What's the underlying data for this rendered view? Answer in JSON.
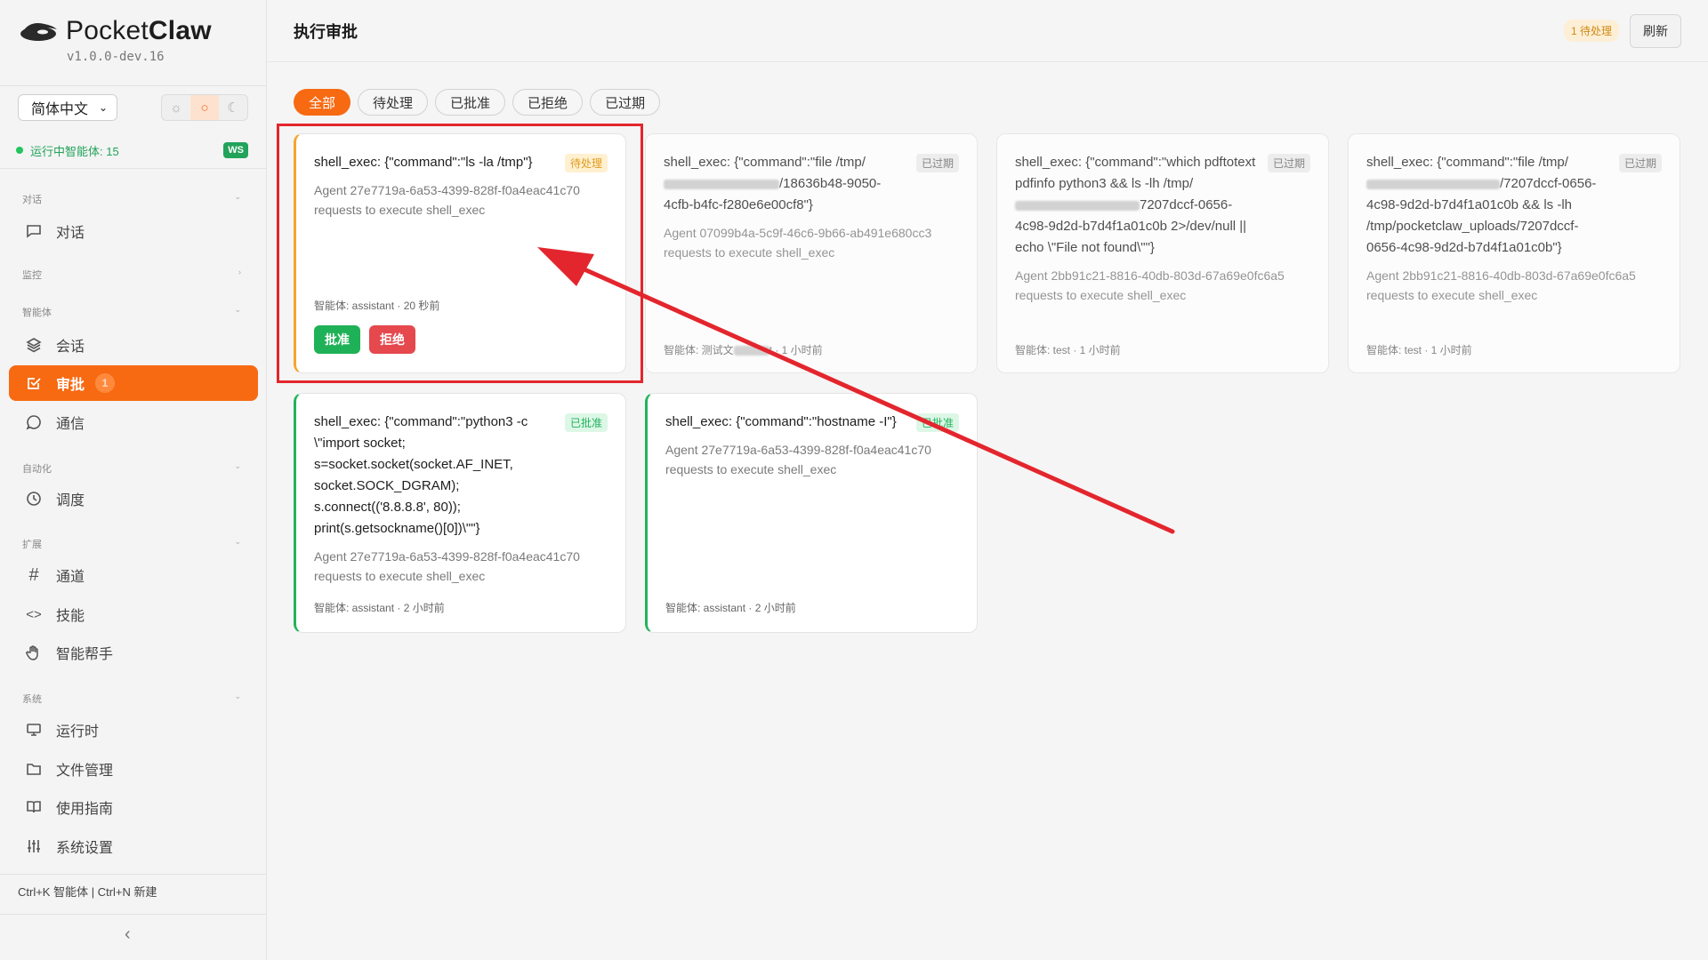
{
  "app": {
    "brand_light": "Pocket",
    "brand_bold": "Claw",
    "version": "v1.0.0-dev.16"
  },
  "sidebar": {
    "language": "简体中文",
    "theme_icons": [
      "sun-icon",
      "system-icon",
      "moon-icon"
    ],
    "status_text": "运行中智能体: 15",
    "ws_badge": "WS",
    "sections": [
      {
        "label": "对话",
        "items": [
          {
            "label": "对话",
            "icon": "chat-icon"
          }
        ]
      },
      {
        "label": "监控",
        "items": []
      },
      {
        "label": "智能体",
        "items": [
          {
            "label": "会话",
            "icon": "layers-icon"
          },
          {
            "label": "审批",
            "icon": "check-square-icon",
            "badge": "1",
            "active": true
          },
          {
            "label": "通信",
            "icon": "message-icon"
          }
        ]
      },
      {
        "label": "自动化",
        "items": [
          {
            "label": "调度",
            "icon": "clock-icon"
          }
        ]
      },
      {
        "label": "扩展",
        "items": [
          {
            "label": "通道",
            "icon": "hash-icon"
          },
          {
            "label": "技能",
            "icon": "code-icon"
          },
          {
            "label": "智能帮手",
            "icon": "hand-icon"
          }
        ]
      },
      {
        "label": "系统",
        "items": [
          {
            "label": "运行时",
            "icon": "monitor-icon"
          },
          {
            "label": "文件管理",
            "icon": "folder-icon"
          },
          {
            "label": "使用指南",
            "icon": "book-icon"
          },
          {
            "label": "系统设置",
            "icon": "sliders-icon"
          }
        ]
      }
    ],
    "shortcut_hint": "Ctrl+K 智能体 | Ctrl+N 新建",
    "collapse_label": "‹"
  },
  "header": {
    "title": "执行审批",
    "pending_pill": "1 待处理",
    "refresh_label": "刷新"
  },
  "tabs": [
    "全部",
    "待处理",
    "已批准",
    "已拒绝",
    "已过期"
  ],
  "active_tab": "全部",
  "cards": [
    {
      "command": "shell_exec: {\"command\":\"ls -la /tmp\"}",
      "status": "待处理",
      "description": "Agent 27e7719a-6a53-4399-828f-f0a4eac41c70 requests to execute shell_exec",
      "meta": "智能体: assistant · 20 秒前",
      "approve_label": "批准",
      "reject_label": "拒绝"
    },
    {
      "command_pre": "shell_exec: {\"command\":\"file /tmp/",
      "command_post": "/18636b48-9050-4cfb-b4fc-f280e6e00cf8\"}",
      "status": "已过期",
      "description": "Agent 07099b4a-5c9f-46c6-9b66-ab491e680cc3 requests to execute shell_exec",
      "meta_pre": "智能体: 测试文",
      "meta_post": "t · 1 小时前"
    },
    {
      "command_pre": "shell_exec: {\"command\":\"which pdftotext pdfinfo python3 && ls -lh /tmp/",
      "command_post": "7207dccf-0656-4c98-9d2d-b7d4f1a01c0b 2>/dev/null || echo \\\"File not found\\\"\"}",
      "status": "已过期",
      "description": "Agent 2bb91c21-8816-40db-803d-67a69e0fc6a5 requests to execute shell_exec",
      "meta": "智能体: test · 1 小时前"
    },
    {
      "command_pre": "shell_exec: {\"command\":\"file /tmp/",
      "command_post": "/7207dccf-0656-4c98-9d2d-b7d4f1a01c0b && ls -lh /tmp/pocketclaw_uploads/7207dccf-0656-4c98-9d2d-b7d4f1a01c0b\"}",
      "status": "已过期",
      "description": "Agent 2bb91c21-8816-40db-803d-67a69e0fc6a5 requests to execute shell_exec",
      "meta": "智能体: test · 1 小时前"
    },
    {
      "command": "shell_exec: {\"command\":\"python3 -c \\\"import socket; s=socket.socket(socket.AF_INET, socket.SOCK_DGRAM); s.connect(('8.8.8.8', 80)); print(s.getsockname()[0])\\\"\"}",
      "status": "已批准",
      "description": "Agent 27e7719a-6a53-4399-828f-f0a4eac41c70 requests to execute shell_exec",
      "meta": "智能体: assistant · 2 小时前"
    },
    {
      "command": "shell_exec: {\"command\":\"hostname -I\"}",
      "status": "已批准",
      "description": "Agent 27e7719a-6a53-4399-828f-f0a4eac41c70 requests to execute shell_exec",
      "meta": "智能体: assistant · 2 小时前"
    }
  ],
  "colors": {
    "accent": "#f76a12",
    "pending": "#f4a62a",
    "approved": "#22b35c",
    "reject": "#e5484d",
    "annotation_red": "#e3262d"
  }
}
